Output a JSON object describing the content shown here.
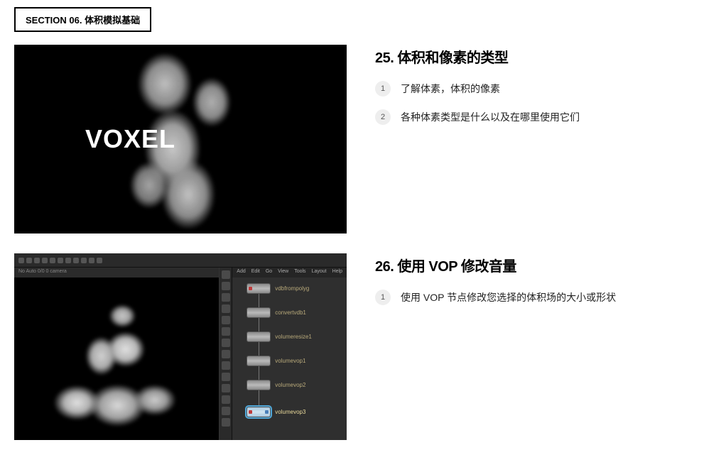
{
  "section_tag": "SECTION 06. 体积模拟基础",
  "lessons": [
    {
      "title": "25. 体积和像素的类型",
      "thumb_overlay": "VOXEL",
      "points": [
        "了解体素，体积的像素",
        "各种体素类型是什么以及在哪里使用它们"
      ]
    },
    {
      "title": "26. 使用 VOP 修改音量",
      "points": [
        "使用 VOP 节点修改您选择的体积场的大小或形状"
      ]
    }
  ],
  "houdini_ui": {
    "viewport_header": "No Auto 0/0 0 camera",
    "net_menu": [
      "Add",
      "Edit",
      "Go",
      "View",
      "Tools",
      "Layout",
      "Help"
    ],
    "nodes": [
      "vdbfrompolyg",
      "convertvdb1",
      "volumeresize1",
      "volumevop1",
      "volumevop2",
      "volumevop3"
    ]
  }
}
